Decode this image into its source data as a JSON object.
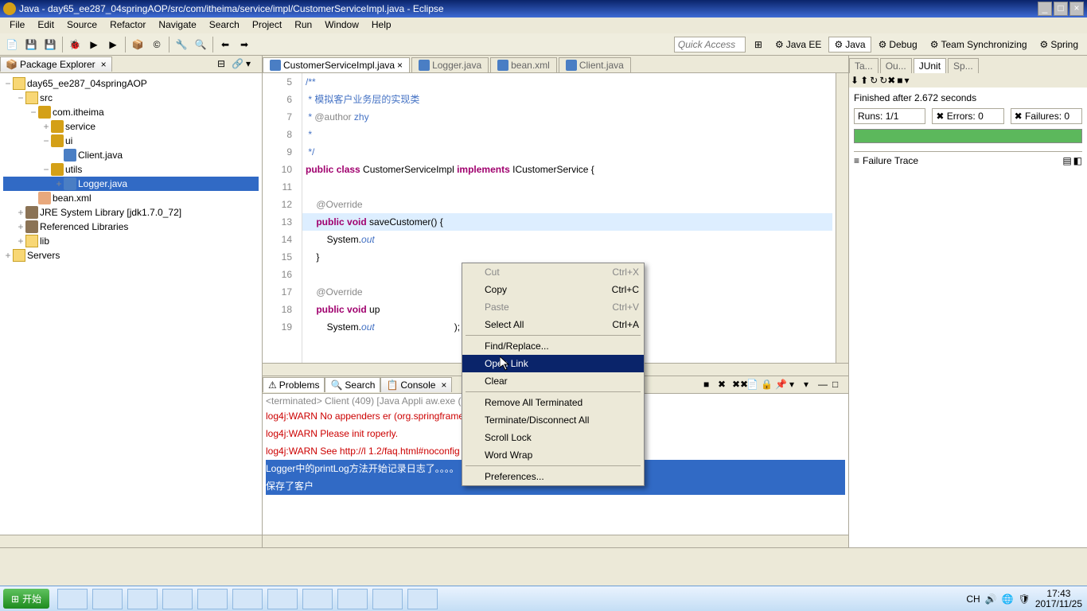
{
  "title": "Java - day65_ee287_04springAOP/src/com/itheima/service/impl/CustomerServiceImpl.java - Eclipse",
  "menu": [
    "File",
    "Edit",
    "Source",
    "Refactor",
    "Navigate",
    "Search",
    "Project",
    "Run",
    "Window",
    "Help"
  ],
  "quick_access_placeholder": "Quick Access",
  "perspectives": [
    {
      "label": "Java EE"
    },
    {
      "label": "Java"
    },
    {
      "label": "Debug"
    },
    {
      "label": "Team Synchronizing"
    },
    {
      "label": "Spring"
    }
  ],
  "package_explorer": {
    "title": "Package Explorer",
    "items": [
      {
        "indent": 0,
        "exp": "−",
        "icon": "folder",
        "label": "day65_ee287_04springAOP"
      },
      {
        "indent": 1,
        "exp": "−",
        "icon": "folder",
        "label": "src"
      },
      {
        "indent": 2,
        "exp": "−",
        "icon": "pkg",
        "label": "com.itheima"
      },
      {
        "indent": 3,
        "exp": "+",
        "icon": "pkg",
        "label": "service"
      },
      {
        "indent": 3,
        "exp": "−",
        "icon": "pkg",
        "label": "ui"
      },
      {
        "indent": 4,
        "exp": "",
        "icon": "java",
        "label": "Client.java"
      },
      {
        "indent": 3,
        "exp": "−",
        "icon": "pkg",
        "label": "utils"
      },
      {
        "indent": 4,
        "exp": "+",
        "icon": "java",
        "label": "Logger.java",
        "selected": true
      },
      {
        "indent": 2,
        "exp": "",
        "icon": "xml",
        "label": "bean.xml"
      },
      {
        "indent": 1,
        "exp": "+",
        "icon": "lib",
        "label": "JRE System Library [jdk1.7.0_72]"
      },
      {
        "indent": 1,
        "exp": "+",
        "icon": "lib",
        "label": "Referenced Libraries"
      },
      {
        "indent": 1,
        "exp": "+",
        "icon": "folder",
        "label": "lib"
      },
      {
        "indent": 0,
        "exp": "+",
        "icon": "folder",
        "label": "Servers"
      }
    ]
  },
  "editor_tabs": [
    {
      "label": "CustomerServiceImpl.java",
      "active": true
    },
    {
      "label": "Logger.java"
    },
    {
      "label": "bean.xml"
    },
    {
      "label": "Client.java"
    }
  ],
  "code_lines": [
    {
      "n": 5,
      "html": "<span class='cm'>/**</span>"
    },
    {
      "n": 6,
      "html": "<span class='cm'> * 模拟客户业务层的实现类</span>"
    },
    {
      "n": 7,
      "html": "<span class='cm'> * <span class='ann'>@author</span> zhy</span>"
    },
    {
      "n": 8,
      "html": "<span class='cm'> *</span>"
    },
    {
      "n": 9,
      "html": "<span class='cm'> */</span>"
    },
    {
      "n": 10,
      "html": "<span class='kw'>public</span> <span class='kw'>class</span> CustomerServiceImpl <span class='kw'>implements</span> ICustomerService {"
    },
    {
      "n": 11,
      "html": ""
    },
    {
      "n": 12,
      "html": "    <span class='ann'>@Override</span>"
    },
    {
      "n": 13,
      "html": "    <span class='kw'>public</span> <span class='kw'>void</span> saveCustomer() {",
      "hl": true
    },
    {
      "n": 14,
      "html": "        System.<span class='st'>out</span>"
    },
    {
      "n": 15,
      "html": "    }"
    },
    {
      "n": 16,
      "html": ""
    },
    {
      "n": 17,
      "html": "    <span class='ann'>@Override</span>"
    },
    {
      "n": 18,
      "html": "    <span class='kw'>public</span> <span class='kw'>void</span> up"
    },
    {
      "n": 19,
      "html": "        System.<span class='st'>out</span>                              );"
    }
  ],
  "bottom_tabs": [
    "Problems",
    "Search",
    "Console"
  ],
  "console_header": "<terminated> Client (409) [Java Appli                              aw.exe (2017年11月25日 下午5:27:38)",
  "console_lines": [
    {
      "cls": "red",
      "text": "log4j:WARN No appenders                            er (org.springframework.core.env.StandardEnvironment)."
    },
    {
      "cls": "red",
      "text": "log4j:WARN Please init                             roperly."
    },
    {
      "cls": "red",
      "text": "log4j:WARN See http://l                            1.2/faq.html#noconfig for more info."
    },
    {
      "cls": "sel",
      "text": "Logger中的printLog方法开始记录日志了。。。。"
    },
    {
      "cls": "sel",
      "text": "保存了客户"
    }
  ],
  "junit": {
    "tabs": [
      "Ta...",
      "Ou...",
      "JUnit",
      "Sp..."
    ],
    "finished": "Finished after 2.672 seconds",
    "runs_label": "Runs:",
    "runs": "1/1",
    "errors_label": "Errors:",
    "errors": "0",
    "failures_label": "Failures:",
    "failures": "0",
    "failure_trace": "Failure Trace"
  },
  "context_menu": [
    {
      "label": "Cut",
      "sc": "Ctrl+X",
      "disabled": true
    },
    {
      "label": "Copy",
      "sc": "Ctrl+C"
    },
    {
      "label": "Paste",
      "sc": "Ctrl+V",
      "disabled": true
    },
    {
      "label": "Select All",
      "sc": "Ctrl+A"
    },
    {
      "sep": true
    },
    {
      "label": "Find/Replace..."
    },
    {
      "label": "Open Link",
      "highlighted": true
    },
    {
      "label": "Clear"
    },
    {
      "sep": true
    },
    {
      "label": "Remove All Terminated"
    },
    {
      "label": "Terminate/Disconnect All"
    },
    {
      "label": "Scroll Lock"
    },
    {
      "label": "Word Wrap"
    },
    {
      "sep": true
    },
    {
      "label": "Preferences..."
    }
  ],
  "taskbar": {
    "start": "开始",
    "lang": "CH",
    "time": "17:43",
    "date": "2017/11/25"
  }
}
